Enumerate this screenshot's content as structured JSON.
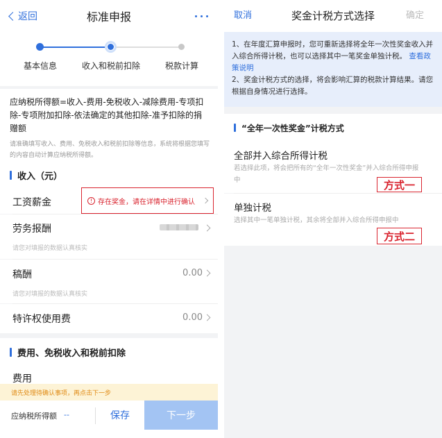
{
  "left": {
    "nav": {
      "back": "返回",
      "title": "标准申报"
    },
    "steps": [
      "基本信息",
      "收入和税前扣除",
      "税款计算"
    ],
    "formula": {
      "text": "应纳税所得额=收入-费用-免税收入-减除费用-专项扣除-专项附加扣除-依法确定的其他扣除-准予扣除的捐赠额",
      "hint": "请准确填写收入、费用、免税收入和税前扣除等信息，系统将根据您填写的内容自动计算应纳税所得额。"
    },
    "income_section": "收入（元）",
    "rows": {
      "salary": {
        "label": "工资薪金",
        "alert": "存在奖金，请在详情中进行确认"
      },
      "labor": {
        "label": "劳务报酬",
        "hint": "请您对填报的数据认真核实"
      },
      "royalty": {
        "label": "稿酬",
        "value": "0.00",
        "hint": "请您对填报的数据认真核实"
      },
      "franchise": {
        "label": "特许权使用费",
        "value": "0.00"
      }
    },
    "deduction_section": "费用、免税收入和税前扣除",
    "expense_label": "费用",
    "warning": "请先处理待确认事项，再点击下一步",
    "footer": {
      "tax_label": "应纳税所得额",
      "tax_value": "--",
      "save": "保存",
      "next": "下一步"
    }
  },
  "right": {
    "nav": {
      "cancel": "取消",
      "title": "奖金计税方式选择",
      "confirm": "确定"
    },
    "notice": {
      "p1": "1、在年度汇算申报时，您可重新选择将全年一次性奖金收入并入综合所得计税，也可以选择其中一笔奖金单独计税。",
      "link": "查看政策说明",
      "p2": "2、奖金计税方式的选择，将会影响汇算的税款计算结果。请您根据自身情况进行选择。"
    },
    "section": "“全年一次性奖金”计税方式",
    "options": [
      {
        "title": "全部并入综合所得计税",
        "desc": "若选择此项，将会把所有的“全年一次性奖金”并入综合所得申报中",
        "tag": "方式一"
      },
      {
        "title": "单独计税",
        "desc": "选择其中一笔单独计税，其余将全部并入综合所得申报中",
        "tag": "方式二"
      }
    ]
  },
  "colors": {
    "accent": "#2f6fdc",
    "alert": "#d9232e",
    "warning_bg": "#fdf3d6",
    "notice_bg": "#e7eefb"
  }
}
